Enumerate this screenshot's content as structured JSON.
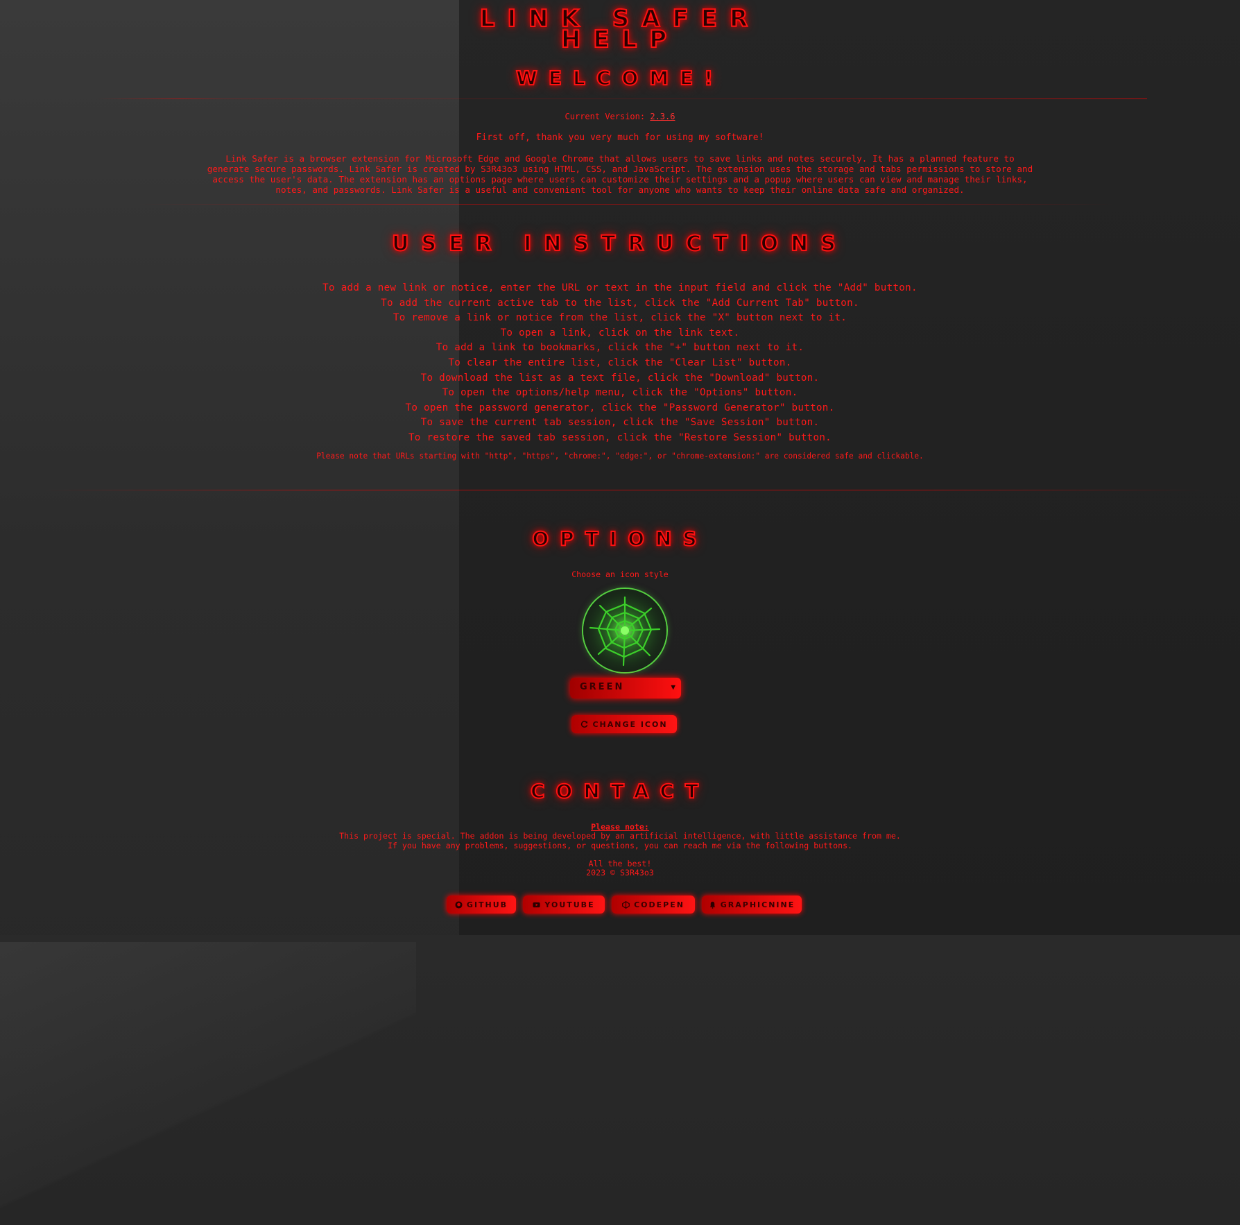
{
  "header": {
    "title_line1": "Link Safer",
    "title_line2": "Help",
    "welcome": "Welcome!"
  },
  "intro": {
    "version_label": "Current Version:",
    "version_value": "2.3.6",
    "thanks": "First off, thank you very much for using my software!",
    "about_lines": [
      "Link Safer is a browser extension for Microsoft Edge and Google Chrome that allows users to save links and notes securely. It has a planned feature to",
      "generate secure passwords. Link Safer is created by S3R43o3 using HTML, CSS, and JavaScript. The extension uses the storage and tabs permissions to store and",
      "access the user's data. The extension has an options page where users can customize their settings and a popup where users can view and manage their links,",
      "notes, and passwords. Link Safer is a useful and convenient tool for anyone who wants to keep their online data safe and organized."
    ]
  },
  "instructions": {
    "heading": "User Instructions",
    "items": [
      "To add a new link or notice, enter the URL or text in the input field and click the \"Add\" button.",
      "To add the current active tab to the list, click the \"Add Current Tab\" button.",
      "To remove a link or notice from the list, click the \"X\" button next to it.",
      "To open a link, click on the link text.",
      "To add a link to bookmarks, click the \"+\" button next to it.",
      "To clear the entire list, click the \"Clear List\" button.",
      "To download the list as a text file, click the \"Download\" button.",
      "To open the options/help menu, click the \"Options\" button.",
      "To open the password generator, click the \"Password Generator\" button.",
      "To save the current tab session, click the \"Save Session\" button.",
      "To restore the saved tab session, click the \"Restore Session\" button."
    ],
    "note": "Please note that URLs starting with \"http\", \"https\", \"chrome:\", \"edge:\", or \"chrome-extension:\" are considered safe and clickable."
  },
  "options": {
    "heading": "Options",
    "icon_style_label": "Choose an icon style",
    "icon_name": "spider-web-icon",
    "selected_style": "Green",
    "change_button": "Change Icon"
  },
  "contact": {
    "heading": "Contact",
    "please_note": "Please note:",
    "line1": "This project is special. The addon is being developed by an artificial intelligence, with little assistance from me.",
    "line2": "If you have any problems, suggestions, or questions, you can reach me via the following buttons.",
    "farewell": "All the best!",
    "copyright": "2023 © S3R43o3",
    "buttons": {
      "github": "GitHub",
      "youtube": "YouTube",
      "codepen": "CodePen",
      "graphicnine": "Graphicnine"
    }
  },
  "colors": {
    "accent": "#ff1a1a",
    "background": "#232323",
    "icon_green": "#55d040"
  }
}
